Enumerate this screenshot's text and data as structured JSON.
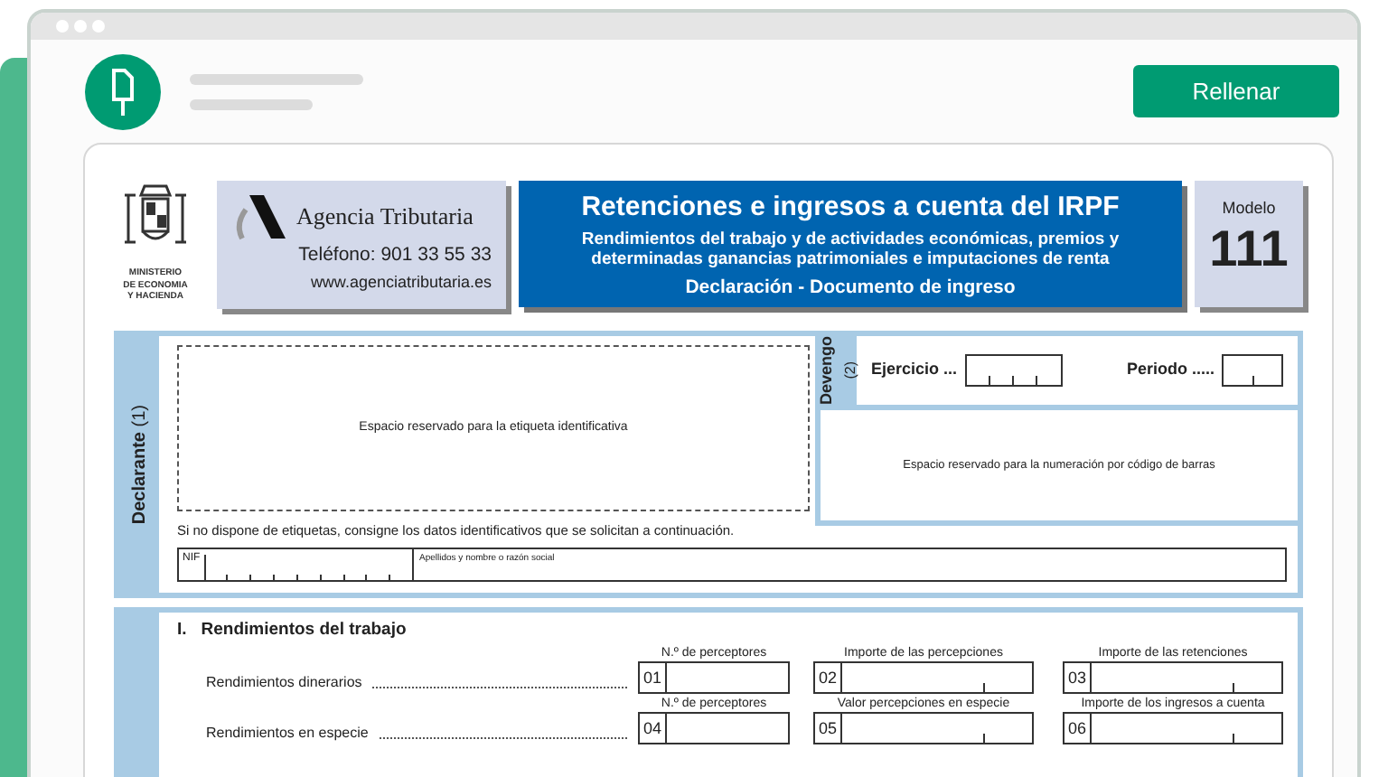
{
  "app": {
    "action_button": "Rellenar"
  },
  "header": {
    "ministry_lines": [
      "MINISTERIO",
      "DE ECONOMIA",
      "Y HACIENDA"
    ],
    "agency": {
      "name": "Agencia Tributaria",
      "phone": "Teléfono: 901 33 55 33",
      "website": "www.agenciatributaria.es"
    },
    "title": "Retenciones e ingresos a cuenta del IRPF",
    "subtitle": "Rendimientos del trabajo y de actividades económicas, premios y determinadas ganancias patrimoniales e imputaciones de renta",
    "document_type": "Declaración - Documento de ingreso",
    "model_label": "Modelo",
    "model_number": "111"
  },
  "declarante": {
    "label": "**Declarante** (1)",
    "label_area": "Espacio reservado para la etiqueta identificativa",
    "note": "Si no dispone de etiquetas, consigne los datos identificativos que se solicitan a continuación.",
    "nif_label": "NIF",
    "name_label": "Apellidos y nombre o razón social"
  },
  "devengo": {
    "label": "Devengo",
    "note": "(2)",
    "ejercicio_label": "Ejercicio ...",
    "periodo_label": "Periodo .....",
    "barcode_area": "Espacio reservado para la numeración por código de barras"
  },
  "section_1": {
    "number": "I.",
    "title": "Rendimientos del trabajo",
    "rows": [
      {
        "label": "Rendimientos dinerarios",
        "fields": [
          {
            "caption": "N.º de perceptores",
            "code": "01",
            "kind": "count"
          },
          {
            "caption": "Importe de las percepciones",
            "code": "02",
            "kind": "amount"
          },
          {
            "caption": "Importe de las retenciones",
            "code": "03",
            "kind": "amount"
          }
        ]
      },
      {
        "label": "Rendimientos en especie",
        "fields": [
          {
            "caption": "N.º de perceptores",
            "code": "04",
            "kind": "count"
          },
          {
            "caption": "Valor percepciones en especie",
            "code": "05",
            "kind": "amount"
          },
          {
            "caption": "Importe de los ingresos a cuenta",
            "code": "06",
            "kind": "amount"
          }
        ]
      }
    ]
  }
}
